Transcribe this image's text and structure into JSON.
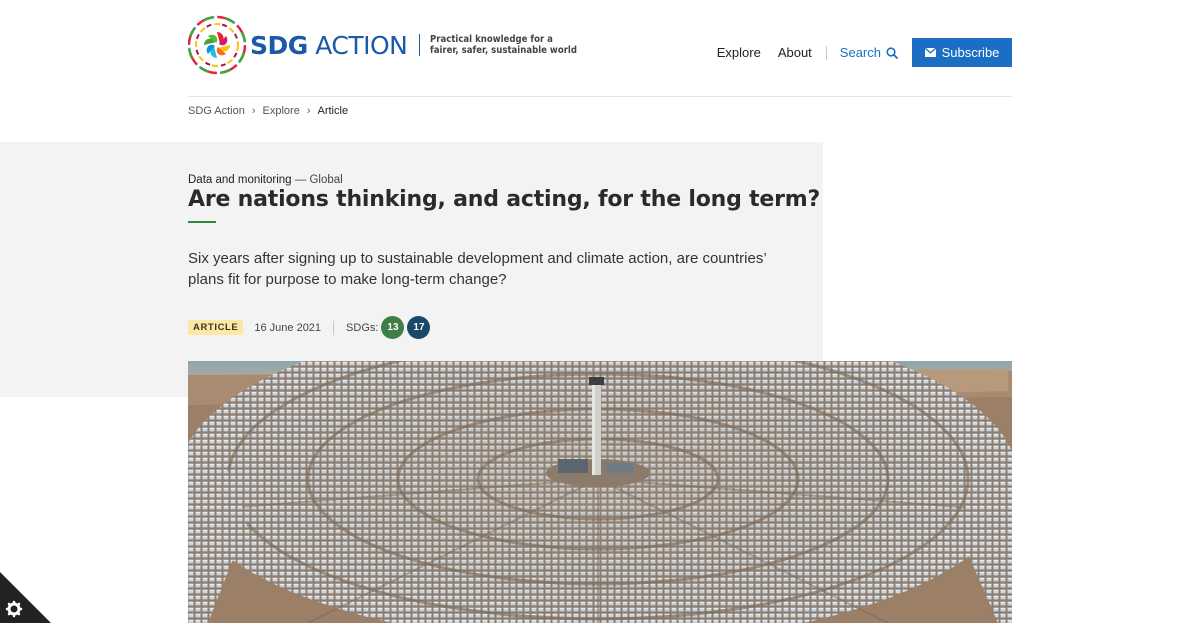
{
  "logo": {
    "name_bold": "SDG",
    "name_rest": " ACTION",
    "tagline_line1": "Practical knowledge for a",
    "tagline_line2": "fairer, safer, sustainable world"
  },
  "nav": {
    "explore": "Explore",
    "about": "About",
    "search": "Search",
    "subscribe": "Subscribe",
    "accent_color": "#1a6fc4"
  },
  "breadcrumb": {
    "items": [
      "SDG Action",
      "Explore",
      "Article"
    ]
  },
  "article": {
    "category": "Data and monitoring",
    "region": " — Global",
    "title": "Are nations thinking, and acting, for the long term?",
    "standfirst": "Six years after signing up to sustainable development and climate action, are countries’ plans fit for purpose to make long-term change?",
    "type_badge": "ARTICLE",
    "date": "16 June 2021",
    "sdgs_label": "SDGs:",
    "sdgs": [
      {
        "number": "13",
        "color": "#3f7e44"
      },
      {
        "number": "17",
        "color": "#19486a"
      }
    ]
  },
  "icons": {
    "search": "search-icon",
    "mail": "mail-icon",
    "cookie": "gear-icon"
  }
}
